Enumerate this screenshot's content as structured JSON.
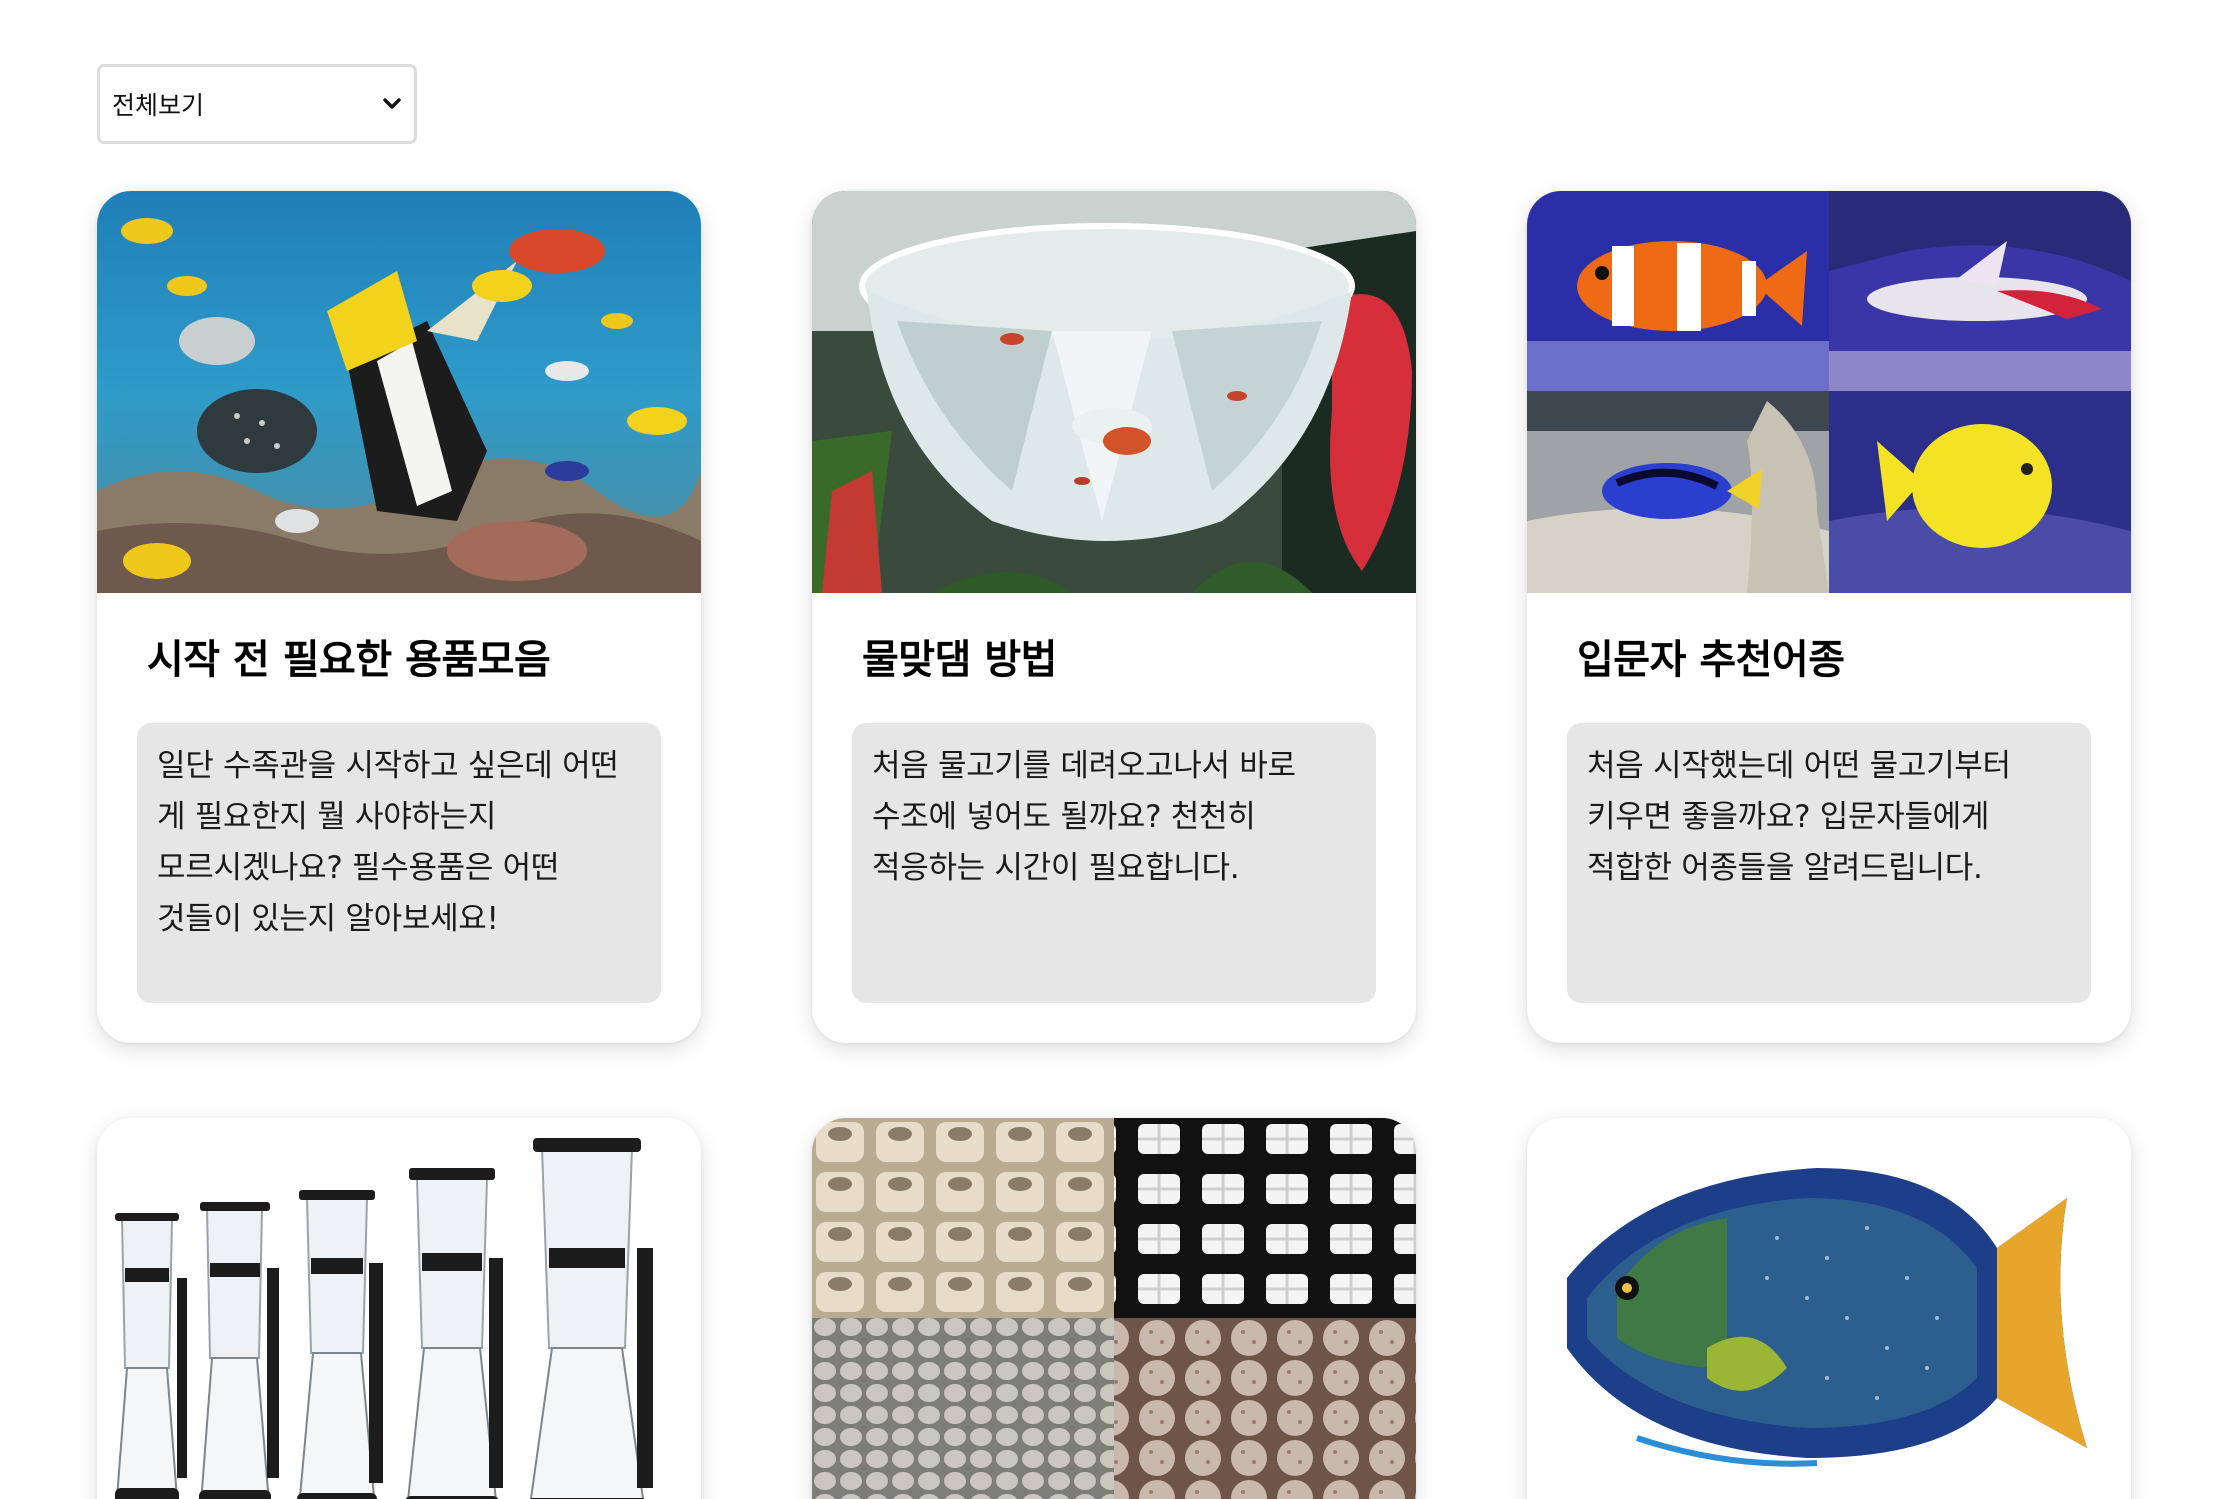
{
  "filter": {
    "selected": "전체보기",
    "icon": "chevron-down-icon"
  },
  "cards": [
    {
      "title": "시작 전 필요한 용품모음",
      "description": "일단 수족관을 시작하고 싶은데 어떤 게 필요한지 뭘 사야하는지 모르시겠나요? 필수용품은 어떤 것들이 있는지 알아보세요!",
      "image": "tropical-fish-aquarium-photo"
    },
    {
      "title": "물맞댐 방법",
      "description": "처음 물고기를 데려오고나서 바로 수조에 넣어도 될까요? 천천히 적응하는 시간이 필요합니다.",
      "image": "fish-acclimation-cup-photo"
    },
    {
      "title": "입문자 추천어종",
      "description": "처음 시작했는데 어떤 물고기부터 키우면 좋을까요? 입문자들에게 적합한 어종들을 알려드립니다.",
      "image": "beginner-fish-collage-photo"
    },
    {
      "title": "",
      "description": "",
      "image": "protein-skimmers-photo"
    },
    {
      "title": "",
      "description": "",
      "image": "filter-media-collage-photo"
    },
    {
      "title": "",
      "description": "",
      "image": "queen-angelfish-photo"
    }
  ],
  "colors": {
    "background": "#ffffff",
    "card": "#ffffff",
    "description_box": "#e6e6e6",
    "select_border": "#dcdcdc"
  }
}
